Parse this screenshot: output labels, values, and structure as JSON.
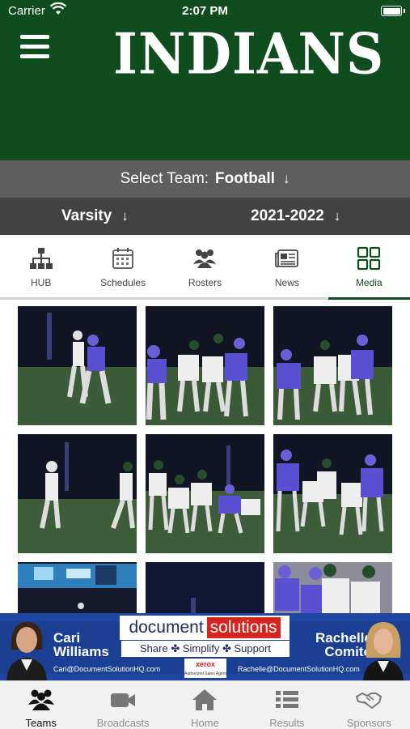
{
  "status_bar": {
    "carrier": "Carrier",
    "time": "2:07 PM"
  },
  "header": {
    "title": "INDIANS",
    "menu_icon": "hamburger-menu-icon",
    "background": "#0f4d1f"
  },
  "team_select": {
    "label": "Select Team:",
    "value": "Football"
  },
  "filters": {
    "level": "Varsity",
    "season": "2021-2022"
  },
  "tabs": [
    {
      "label": "HUB",
      "icon": "hub-hierarchy-icon"
    },
    {
      "label": "Schedules",
      "icon": "calendar-icon"
    },
    {
      "label": "Rosters",
      "icon": "people-group-icon"
    },
    {
      "label": "News",
      "icon": "newspaper-icon"
    },
    {
      "label": "Media",
      "icon": "grid-icon",
      "active": true
    }
  ],
  "media": {
    "visible_photo_count": 9
  },
  "ad": {
    "left_name": "Cari\nWilliams",
    "left_email": "Cari@DocumentSolutionHQ.com",
    "logo_word1": "document",
    "logo_word2": "solutions",
    "tagline": "Share ✤ Simplify ✤ Support",
    "partner": "xerox",
    "partner_sub": "Authorized Sales Agent",
    "right_name": "Rachelle\nComito",
    "right_email": "Rachelle@DocumentSolutionHQ.com"
  },
  "bottom_tabs": [
    {
      "label": "Teams",
      "icon": "teams-icon",
      "active": true
    },
    {
      "label": "Broadcasts",
      "icon": "video-camera-icon"
    },
    {
      "label": "Home",
      "icon": "home-icon"
    },
    {
      "label": "Results",
      "icon": "list-icon"
    },
    {
      "label": "Sponsors",
      "icon": "handshake-icon"
    }
  ],
  "colors": {
    "accent": "#0f4d1f",
    "team_bar": "#5e5e5e",
    "filter_bar": "#424242"
  }
}
